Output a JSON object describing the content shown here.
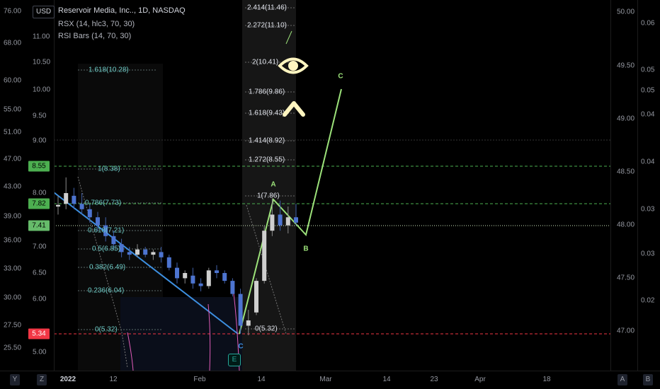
{
  "chart_header": {
    "symbol_title": "Reservoir Media, Inc.., 1D, NASDAQ",
    "indicator_rsx": "RSX (14, hlc3, 70, 30)",
    "indicator_rsi_bars": "RSI Bars (14, 70, 30)",
    "currency": "USD"
  },
  "axes": {
    "far_left": [
      "76.00",
      "68.00",
      "60.00",
      "55.00",
      "51.00",
      "47.00",
      "43.00",
      "39.00",
      "36.00",
      "33.00",
      "30.00",
      "27.50",
      "25.50"
    ],
    "left": [
      "11.00",
      "10.50",
      "10.00",
      "9.50",
      "9.00",
      "8.00",
      "7.00",
      "6.50",
      "6.00",
      "5.00"
    ],
    "right": [
      "50.00",
      "49.50",
      "49.00",
      "48.50",
      "48.00",
      "47.50",
      "47.00"
    ],
    "far_right": [
      "0.06",
      "0.05",
      "0.05",
      "0.04",
      "0.04",
      "0.03",
      "0.03",
      "0.02"
    ],
    "price_labels": [
      {
        "text": "8.55",
        "color": "#4caf50"
      },
      {
        "text": "7.82",
        "color": "#4caf50"
      },
      {
        "text": "7.41",
        "color": "#66bb6a"
      },
      {
        "text": "5.34",
        "color": "#f23645"
      }
    ],
    "time": [
      "Y",
      "Z",
      "2022",
      "12",
      "Feb",
      "14",
      "Mar",
      "14",
      "23",
      "Apr",
      "18",
      "A",
      "B"
    ]
  },
  "fib_left": [
    "1.618(10.28)",
    "1(8.38)",
    "0.786(7.73)",
    "0.618(7.21)",
    "0.5(6.85)",
    "0.382(6.49)",
    "0.236(6.04)",
    "0(5.32)"
  ],
  "fib_right": [
    "2.414(11.46)",
    "2.272(11.10)",
    "2(10.41)",
    "1.786(9.86)",
    "1.618(9.43)",
    "1.414(8.92)",
    "1.272(8.55)",
    "1(7.86)",
    "0(5.32)"
  ],
  "wave_labels": {
    "a": "A",
    "b": "B",
    "c": "C",
    "c_low": "C"
  },
  "earnings_marker": "E",
  "colors": {
    "green_wave": "#9ce27a",
    "blue_trend": "#3d8fe0",
    "dashed_green": "#4caf50",
    "dashed_red": "#f23645",
    "fib_left": "#6cc9c4",
    "eye": "#fff5c0"
  },
  "candles": [
    {
      "o": 7.75,
      "h": 7.95,
      "l": 7.6,
      "c": 7.78
    },
    {
      "o": 7.8,
      "h": 8.3,
      "l": 7.7,
      "c": 8.0
    },
    {
      "o": 7.95,
      "h": 8.1,
      "l": 7.7,
      "c": 7.8
    },
    {
      "o": 7.8,
      "h": 8.0,
      "l": 7.6,
      "c": 7.7
    },
    {
      "o": 7.7,
      "h": 7.8,
      "l": 7.45,
      "c": 7.55
    },
    {
      "o": 7.55,
      "h": 7.65,
      "l": 7.3,
      "c": 7.4
    },
    {
      "o": 7.4,
      "h": 7.55,
      "l": 7.1,
      "c": 7.2
    },
    {
      "o": 7.2,
      "h": 7.3,
      "l": 6.95,
      "c": 7.05
    },
    {
      "o": 7.05,
      "h": 7.15,
      "l": 6.8,
      "c": 6.9
    },
    {
      "o": 6.9,
      "h": 7.0,
      "l": 6.75,
      "c": 6.85
    },
    {
      "o": 6.85,
      "h": 7.05,
      "l": 6.8,
      "c": 6.95
    },
    {
      "o": 6.95,
      "h": 7.0,
      "l": 6.8,
      "c": 6.85
    },
    {
      "o": 6.85,
      "h": 6.95,
      "l": 6.75,
      "c": 6.9
    },
    {
      "o": 6.9,
      "h": 7.0,
      "l": 6.7,
      "c": 6.8
    },
    {
      "o": 6.8,
      "h": 6.85,
      "l": 6.55,
      "c": 6.6
    },
    {
      "o": 6.6,
      "h": 6.7,
      "l": 6.3,
      "c": 6.4
    },
    {
      "o": 6.4,
      "h": 6.55,
      "l": 6.3,
      "c": 6.5
    },
    {
      "o": 6.45,
      "h": 6.6,
      "l": 6.2,
      "c": 6.3
    },
    {
      "o": 6.3,
      "h": 6.4,
      "l": 6.15,
      "c": 6.25
    },
    {
      "o": 6.25,
      "h": 6.6,
      "l": 6.2,
      "c": 6.55
    },
    {
      "o": 6.55,
      "h": 6.65,
      "l": 6.4,
      "c": 6.5
    },
    {
      "o": 6.5,
      "h": 6.55,
      "l": 6.3,
      "c": 6.35
    },
    {
      "o": 6.35,
      "h": 6.4,
      "l": 6.05,
      "c": 6.1
    },
    {
      "o": 6.1,
      "h": 6.2,
      "l": 5.35,
      "c": 5.5
    },
    {
      "o": 5.5,
      "h": 5.8,
      "l": 5.32,
      "c": 5.6
    },
    {
      "o": 5.75,
      "h": 6.4,
      "l": 5.7,
      "c": 6.35
    },
    {
      "o": 6.35,
      "h": 7.4,
      "l": 6.3,
      "c": 7.3
    },
    {
      "o": 7.3,
      "h": 7.9,
      "l": 7.2,
      "c": 7.6
    },
    {
      "o": 7.6,
      "h": 7.86,
      "l": 7.3,
      "c": 7.4
    },
    {
      "o": 7.4,
      "h": 7.75,
      "l": 7.25,
      "c": 7.55
    },
    {
      "o": 7.55,
      "h": 7.8,
      "l": 7.4,
      "c": 7.45
    }
  ]
}
